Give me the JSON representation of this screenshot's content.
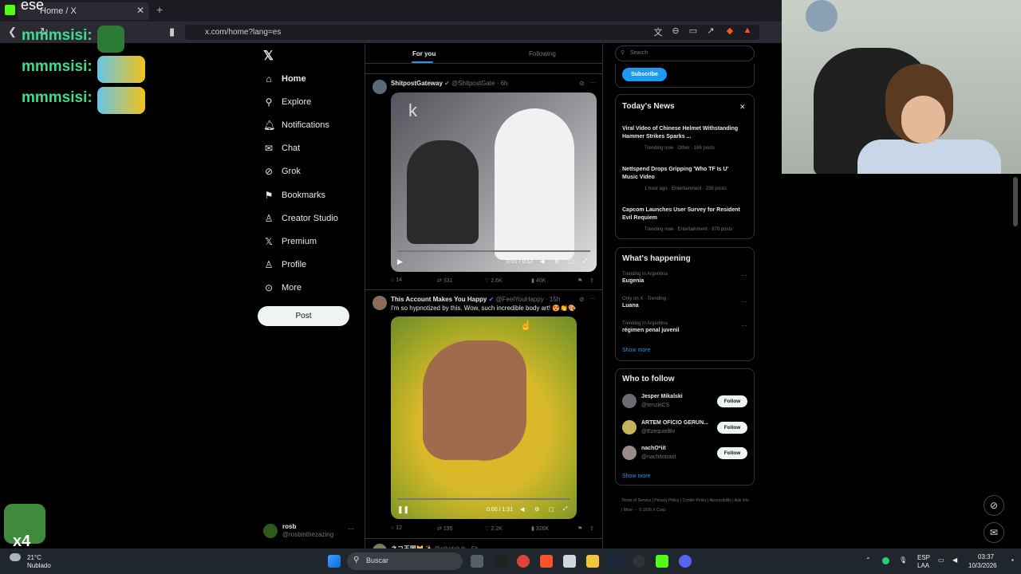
{
  "browser": {
    "tab_title": "Home / X",
    "url": "x.com/home?lang=es"
  },
  "stream_overlay": {
    "top_text": "ese",
    "chat": [
      "mmmsisi:",
      "mmmsisi:",
      "mmmsisi:"
    ],
    "badge": "x4"
  },
  "sidebar": {
    "items": [
      {
        "label": "Home",
        "icon": "home-icon"
      },
      {
        "label": "Explore",
        "icon": "search-icon"
      },
      {
        "label": "Notifications",
        "icon": "bell-icon"
      },
      {
        "label": "Chat",
        "icon": "mail-icon"
      },
      {
        "label": "Grok",
        "icon": "grok-icon"
      },
      {
        "label": "Bookmarks",
        "icon": "bookmark-icon"
      },
      {
        "label": "Creator Studio",
        "icon": "creator-icon"
      },
      {
        "label": "Premium",
        "icon": "x-icon"
      },
      {
        "label": "Profile",
        "icon": "person-icon"
      },
      {
        "label": "More",
        "icon": "more-icon"
      }
    ],
    "post_label": "Post",
    "account_name": "rosb",
    "account_handle": "@rosbinthezazing"
  },
  "feed": {
    "tabs": [
      "For you",
      "Following"
    ],
    "tweets": [
      {
        "name": "ShitpostGateway",
        "handle": "@ShitpostGate",
        "time": "· 6h",
        "text": "",
        "time_display": "0:01 / 0:12",
        "replies": "14",
        "reposts": "331",
        "likes": "2.6K",
        "views": "40K"
      },
      {
        "name": "This Account Makes You Happy",
        "handle": "@FeelYouHappy",
        "time": "· 15h",
        "text": "I'm so hypnotized by this. Wow, such incredible body art! 😍👏🎨",
        "time_display": "0:00 / 1:31",
        "replies": "12",
        "reposts": "195",
        "likes": "2.2K",
        "views": "326K"
      },
      {
        "name": "ネコ王国🐱✨",
        "handle": "@nikotclub",
        "time": "· 5h"
      }
    ]
  },
  "right": {
    "search_placeholder": "Search",
    "subscribe_label": "Subscribe",
    "news_title": "Today's News",
    "news": [
      {
        "headline": "Viral Video of Chinese Helmet Withstanding Hammer Strikes Sparks ...",
        "meta": "Trending now · Other · 166 posts"
      },
      {
        "headline": "Nettspend Drops Gripping 'Who TF Is U' Music Video",
        "meta": "1 hour ago · Entertainment · 236 posts"
      },
      {
        "headline": "Capcom Launches User Survey for Resident Evil Requiem",
        "meta": "Trending now · Entertainment · 970 posts"
      }
    ],
    "happening_title": "What's happening",
    "trends": [
      {
        "context": "Trending in Argentina",
        "name": "Eugenia"
      },
      {
        "context": "Only on X · Trending",
        "name": "Luana"
      },
      {
        "context": "Trending in Argentina",
        "name": "régimen penal juvenil"
      }
    ],
    "show_more": "Show more",
    "follow_title": "Who to follow",
    "follows": [
      {
        "name": "Jesper Mikalski",
        "handle": "@tenzkiCS"
      },
      {
        "name": "ARTEM OFICIO GERUN...",
        "handle": "@EzequielBv"
      },
      {
        "name": "nachO*iit",
        "handle": "@nachitotrast"
      }
    ],
    "follow_label": "Follow",
    "footer": "Terms of Service | Privacy Policy | Cookie Policy | Accessibility | Ads info | More ··· © 2026 X Corp."
  },
  "taskbar": {
    "weather_temp": "21°C",
    "weather_desc": "Nublado",
    "search_label": "Buscar",
    "lang1": "ESP",
    "lang2": "LAA",
    "time": "03:37",
    "date": "10/3/2026"
  }
}
